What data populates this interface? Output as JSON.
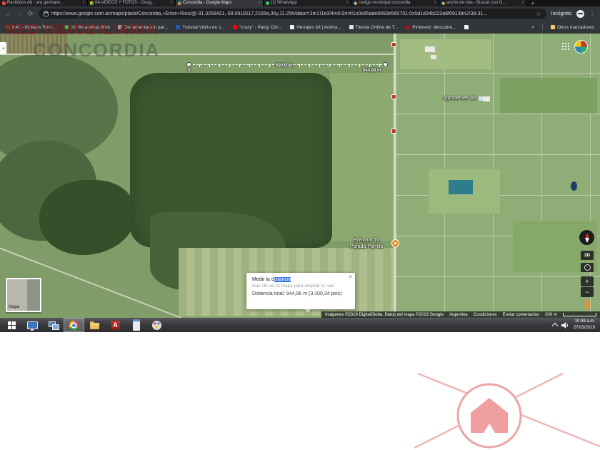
{
  "browser": {
    "tab_close_glyph": "×",
    "new_tab_glyph": "+",
    "tabs": [
      {
        "label": "Recibidos (4) - arq.germanv...",
        "icon": "gmail"
      },
      {
        "label": "04-VIDEOS Y FOTOS - Goog...",
        "icon": "drive"
      },
      {
        "label": "Concordia - Google Maps",
        "icon": "maps"
      },
      {
        "label": "(1) WhatsApp",
        "icon": "whatsapp"
      },
      {
        "label": "codigo municipal concordia",
        "icon": "google"
      },
      {
        "label": "ancho de ruta - Buscar con G...",
        "icon": "google"
      }
    ],
    "toolbar": {
      "back_icon": "←",
      "forward_icon": "→",
      "reload_icon": "⟳",
      "url": "https://www.google.com.ar/maps/place/Concordia,+Entre+Rios/@-31.3258421,-58.0918117,2165a,35y,11.25h/data=!3m1!1e3!4m5!3m4!1s0x95ade8093e560701:0x5d1d34b223a6f091!8m2!3d-31...",
      "star_icon": "☆",
      "incognito_label": "Incógnito",
      "menu_icon": "⋮"
    },
    "bookmarks": [
      {
        "label": "KAT - Kickass Torre...",
        "icon": "kat"
      },
      {
        "label": "(6) WhatsApp Web",
        "icon": "whatsapp"
      },
      {
        "label": "Documentación par...",
        "icon": "doc"
      },
      {
        "label": "Tutorial Vidrio en s...",
        "icon": "taringa"
      },
      {
        "label": "\"crazy\" - Patsy Clin...",
        "icon": "youtube"
      },
      {
        "label": "Herrajes MI | Anima...",
        "icon": "page"
      },
      {
        "label": "Tienda Online de T...",
        "icon": "shop"
      },
      {
        "label": "Pinterest: descubre...",
        "icon": "pinterest"
      },
      {
        "label": "",
        "icon": "page"
      }
    ],
    "bookmarks_overflow_glyph": "»",
    "other_bookmarks_label": "Otros marcadores"
  },
  "watermark": {
    "top_text": "RED INMOBILIARIA",
    "map_text": "CONCORDIA",
    "accent_color": "#941818",
    "logo_color": "#eda4a4"
  },
  "map": {
    "measurement": {
      "start_label": "0",
      "mid_label": "500,00 m",
      "end_label": "944,98 m"
    },
    "places": {
      "agroberries": "Agroberries SA",
      "raton_line1": "El Raton Tu",
      "raton_line2": "Parada Parrilla"
    },
    "controls": {
      "three_d": "3D",
      "zoom_in": "+",
      "zoom_out": "−",
      "minimap_label": "Mapa",
      "collapse_arrow": "◂"
    },
    "attribution": {
      "imagery": "Imágenes ©2019 DigitalGlobe, Datos del mapa ©2019 Google",
      "links": [
        "Argentina",
        "Condiciones",
        "Enviar comentarios"
      ],
      "scale_label": "200 m"
    }
  },
  "measure_popup": {
    "title_prefix": "Medir la d",
    "title_selected": "istancia",
    "hint": "Haz clic en el mapa para ampliar la ruta",
    "total": "Distancia total: 944,98 m (3.100,34 pies)",
    "close_glyph": "×"
  },
  "taskbar": {
    "time": "10:49 a.m.",
    "date": "27/03/2019"
  }
}
